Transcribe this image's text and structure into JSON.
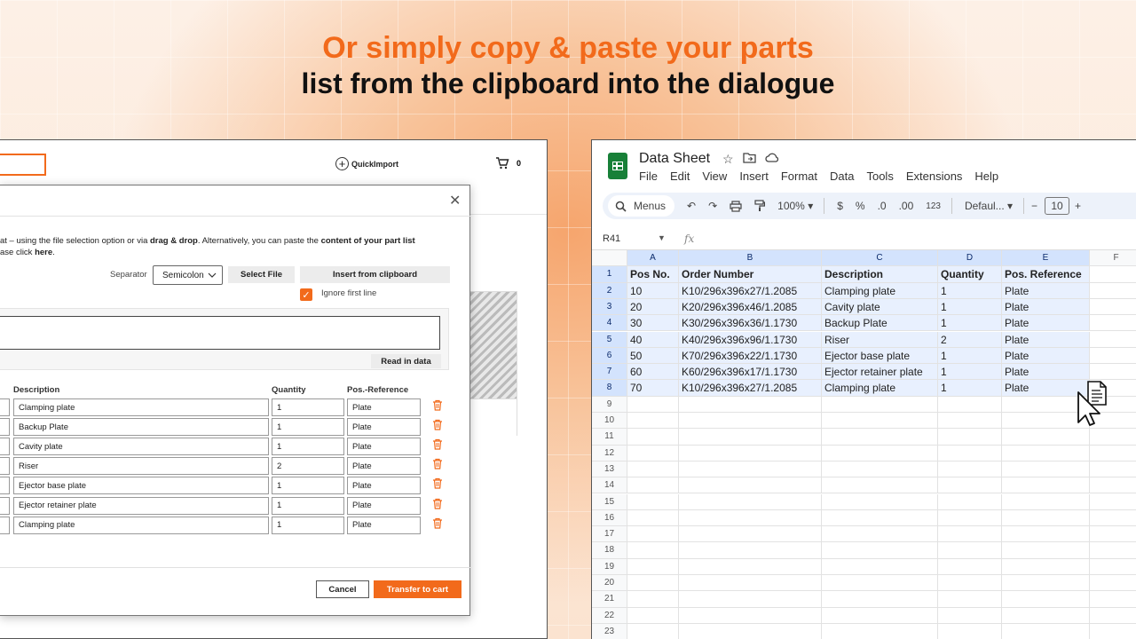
{
  "headline": {
    "line1": "Or simply copy & paste your parts",
    "line2": "list from the clipboard into the dialogue"
  },
  "web": {
    "quickimport_label": "QuickImport",
    "cart_count": "0",
    "dialog": {
      "intro_line1_a": "at – using the file selection option or via ",
      "intro_line1_b": "drag & drop",
      "intro_line1_c": ". Alternatively, you can paste the ",
      "intro_line1_d": "content of your part list",
      "intro_line2_a": "ase click ",
      "intro_line2_b": "here",
      "intro_line2_c": ".",
      "separator_label": "Separator",
      "separator_value": "Semicolon",
      "select_file": "Select File",
      "insert_clipboard": "Insert from clipboard",
      "ignore_first_line": "Ignore first line",
      "read_in_data": "Read in data",
      "columns": [
        "Description",
        "Quantity",
        "Pos.-Reference"
      ],
      "rows": [
        {
          "description": "Clamping plate",
          "quantity": "1",
          "posref": "Plate"
        },
        {
          "description": "Backup Plate",
          "quantity": "1",
          "posref": "Plate"
        },
        {
          "description": "Cavity plate",
          "quantity": "1",
          "posref": "Plate"
        },
        {
          "description": "Riser",
          "quantity": "2",
          "posref": "Plate"
        },
        {
          "description": "Ejector base plate",
          "quantity": "1",
          "posref": "Plate"
        },
        {
          "description": "Ejector retainer plate",
          "quantity": "1",
          "posref": "Plate"
        },
        {
          "description": "Clamping plate",
          "quantity": "1",
          "posref": "Plate"
        }
      ],
      "cancel": "Cancel",
      "transfer": "Transfer to cart"
    }
  },
  "sheet": {
    "title": "Data Sheet",
    "menu": [
      "File",
      "Edit",
      "View",
      "Insert",
      "Format",
      "Data",
      "Tools",
      "Extensions",
      "Help"
    ],
    "toolbar": {
      "menus": "Menus",
      "zoom": "100%",
      "currency": "$",
      "percent": "%",
      "dec_dec": ".0",
      "dec_inc": ".00",
      "num_format": "123",
      "font": "Defaul...",
      "font_size": "10"
    },
    "name_box": "R41",
    "col_letters": [
      "A",
      "B",
      "C",
      "D",
      "E",
      "F"
    ],
    "header_row": [
      "Pos No.",
      "Order Number",
      "Description",
      "Quantity",
      "Pos. Reference"
    ],
    "data_rows": [
      [
        "10",
        "K10/296x396x27/1.2085",
        "Clamping plate",
        "1",
        "Plate"
      ],
      [
        "20",
        "K20/296x396x46/1.2085",
        "Cavity plate",
        "1",
        "Plate"
      ],
      [
        "30",
        "K30/296x396x36/1.1730",
        "Backup Plate",
        "1",
        "Plate"
      ],
      [
        "40",
        "K40/296x396x96/1.1730",
        "Riser",
        "2",
        "Plate"
      ],
      [
        "50",
        "K70/296x396x22/1.1730",
        "Ejector base plate",
        "1",
        "Plate"
      ],
      [
        "60",
        "K60/296x396x17/1.1730",
        "Ejector retainer plate",
        "1",
        "Plate"
      ],
      [
        "70",
        "K10/296x396x27/1.2085",
        "Clamping plate",
        "1",
        "Plate"
      ]
    ],
    "row_numbers": [
      "1",
      "2",
      "3",
      "4",
      "5",
      "6",
      "7",
      "8",
      "9",
      "10",
      "11",
      "12",
      "13",
      "14",
      "15",
      "16",
      "17",
      "18",
      "19",
      "20",
      "21",
      "22",
      "23"
    ]
  }
}
